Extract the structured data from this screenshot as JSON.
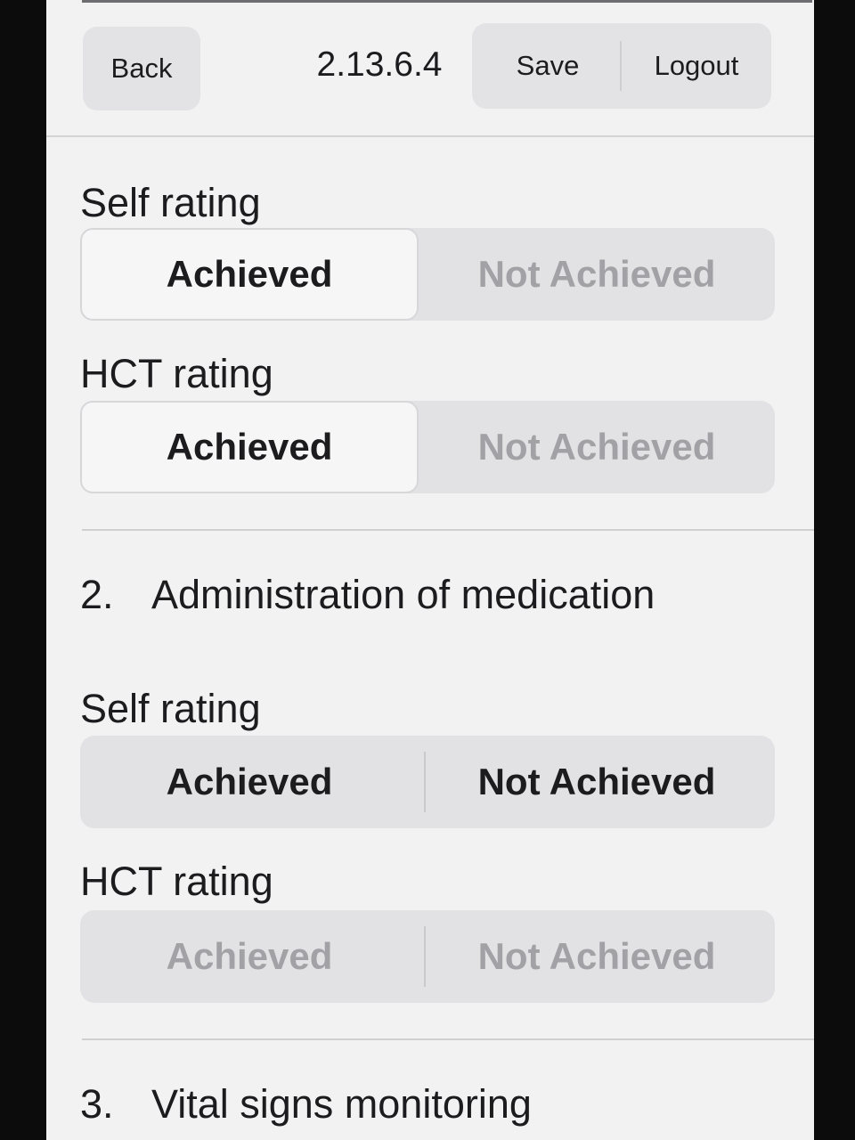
{
  "header": {
    "back_label": "Back",
    "version": "2.13.6.4",
    "save_label": "Save",
    "logout_label": "Logout"
  },
  "section1": {
    "self_rating": {
      "label": "Self rating",
      "achieved": "Achieved",
      "not_achieved": "Not Achieved",
      "selected": "Achieved"
    },
    "hct_rating": {
      "label": "HCT rating",
      "achieved": "Achieved",
      "not_achieved": "Not Achieved",
      "selected": "Achieved"
    }
  },
  "section2": {
    "number": "2.",
    "title": "Administration of medication",
    "self_rating": {
      "label": "Self rating",
      "achieved": "Achieved",
      "not_achieved": "Not Achieved",
      "selected": "none"
    },
    "hct_rating": {
      "label": "HCT rating",
      "achieved": "Achieved",
      "not_achieved": "Not Achieved",
      "selected": "none",
      "disabled": true
    }
  },
  "section3": {
    "number": "3.",
    "title": "Vital signs monitoring"
  }
}
